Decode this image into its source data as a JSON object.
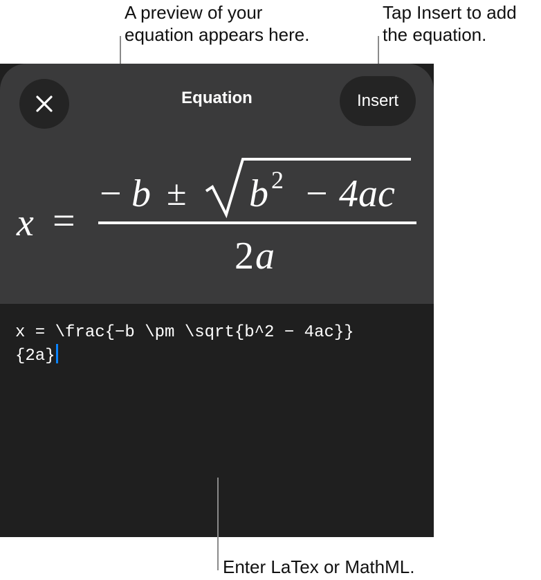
{
  "callouts": {
    "preview": [
      "A preview of your",
      "equation appears here."
    ],
    "insert": [
      "Tap Insert to add",
      "the equation."
    ],
    "latex": "Enter LaTex or MathML."
  },
  "header": {
    "title": "Equation",
    "insert_label": "Insert",
    "close_icon": "close-icon"
  },
  "equation": {
    "lhs": "x",
    "equals": "=",
    "minus": "−",
    "b": "b",
    "pm": "±",
    "radicand_base": "b",
    "radicand_exp": "2",
    "radicand_minus": "−",
    "radicand_rest": "4ac",
    "denominator_coef": "2",
    "denominator_var": "a"
  },
  "editor": {
    "lines": [
      "x = \\frac{−b \\pm \\sqrt{b^2 − 4ac}}",
      "{2a}"
    ]
  },
  "colors": {
    "sheet_top": "#3a3a3b",
    "sheet_bottom": "#1f1f1f",
    "button_bg": "#242424",
    "cursor": "#0a84ff"
  }
}
